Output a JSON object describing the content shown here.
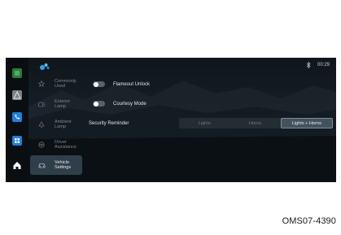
{
  "status_bar": {
    "bluetooth_icon": "bluetooth-icon",
    "time": "00:29"
  },
  "dock": {
    "items": [
      {
        "icon": "app-icon",
        "color": "#2a7a3a"
      },
      {
        "icon": "navigation-icon",
        "color": "#7a8288"
      },
      {
        "icon": "phone-icon",
        "color": "#1e7fe0"
      },
      {
        "icon": "apps-grid-icon",
        "color": "#1e7fe0"
      },
      {
        "icon": "home-icon",
        "color": "#ffffff"
      }
    ]
  },
  "sidebar": {
    "items": [
      {
        "label": "Commonly\nUsed",
        "icon": "star-icon"
      },
      {
        "label": "Exterior\nLamp",
        "icon": "exterior-lamp-icon"
      },
      {
        "label": "Ambient\nLamp",
        "icon": "ambient-lamp-icon"
      },
      {
        "label": "Driver\nAssistance",
        "icon": "steering-wheel-icon"
      },
      {
        "label": "Vehicle\nSettings",
        "icon": "car-icon",
        "active": true
      }
    ]
  },
  "settings": {
    "flameout_unlock": {
      "label": "Flameout Unlock",
      "enabled": false
    },
    "courtesy_mode": {
      "label": "Courtesy Mode",
      "enabled": false
    },
    "security_reminder": {
      "label": "Security Reminder",
      "options": [
        "Lights",
        "Horns",
        "Lights + Horns"
      ],
      "selected": "Lights + Horns"
    }
  },
  "caption": "OMS07-4390",
  "colors": {
    "accent": "#1e7fe0",
    "background": "#0d1318",
    "active_menu": "#2f3f4a",
    "text_primary": "#e1e5e8",
    "text_secondary": "#7d8890"
  }
}
